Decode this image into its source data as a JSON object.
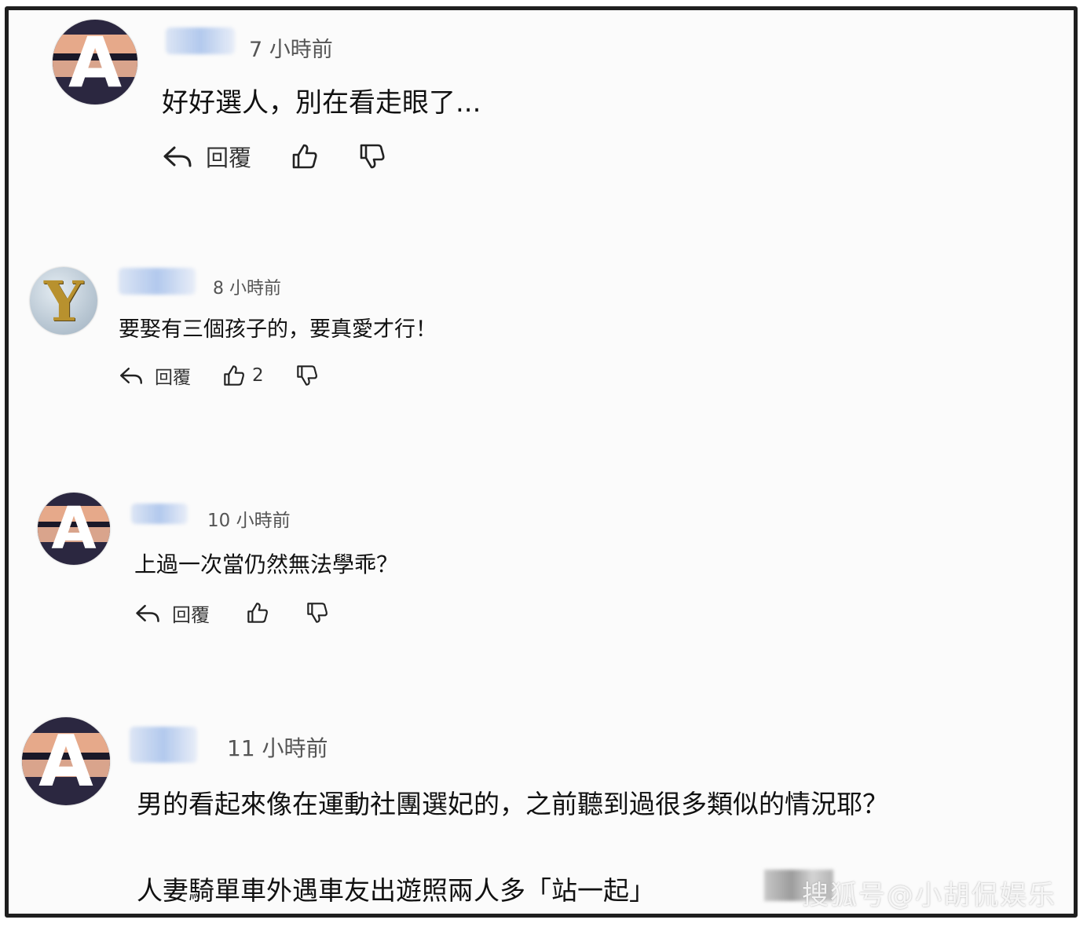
{
  "comments": [
    {
      "time": "7 小時前",
      "text": "好好選人，別在看走眼了...",
      "reply_label": "回覆",
      "like_count": "",
      "avatar_letter": "A"
    },
    {
      "time": "8 小時前",
      "text": "要娶有三個孩子的，要真愛才行！",
      "reply_label": "回覆",
      "like_count": "2",
      "avatar_letter": "Y"
    },
    {
      "time": "10 小時前",
      "text": "上過一次當仍然無法學乖？",
      "reply_label": "回覆",
      "like_count": "",
      "avatar_letter": "A"
    },
    {
      "time": "11 小時前",
      "text": "男的看起來像在運動社團選妃的，之前聽到過很多類似的情況耶？",
      "text2": "人妻騎單車外遇車友出遊照兩人多「站一起」",
      "avatar_letter": "A"
    }
  ],
  "watermark": "搜狐号@小胡侃娱乐"
}
